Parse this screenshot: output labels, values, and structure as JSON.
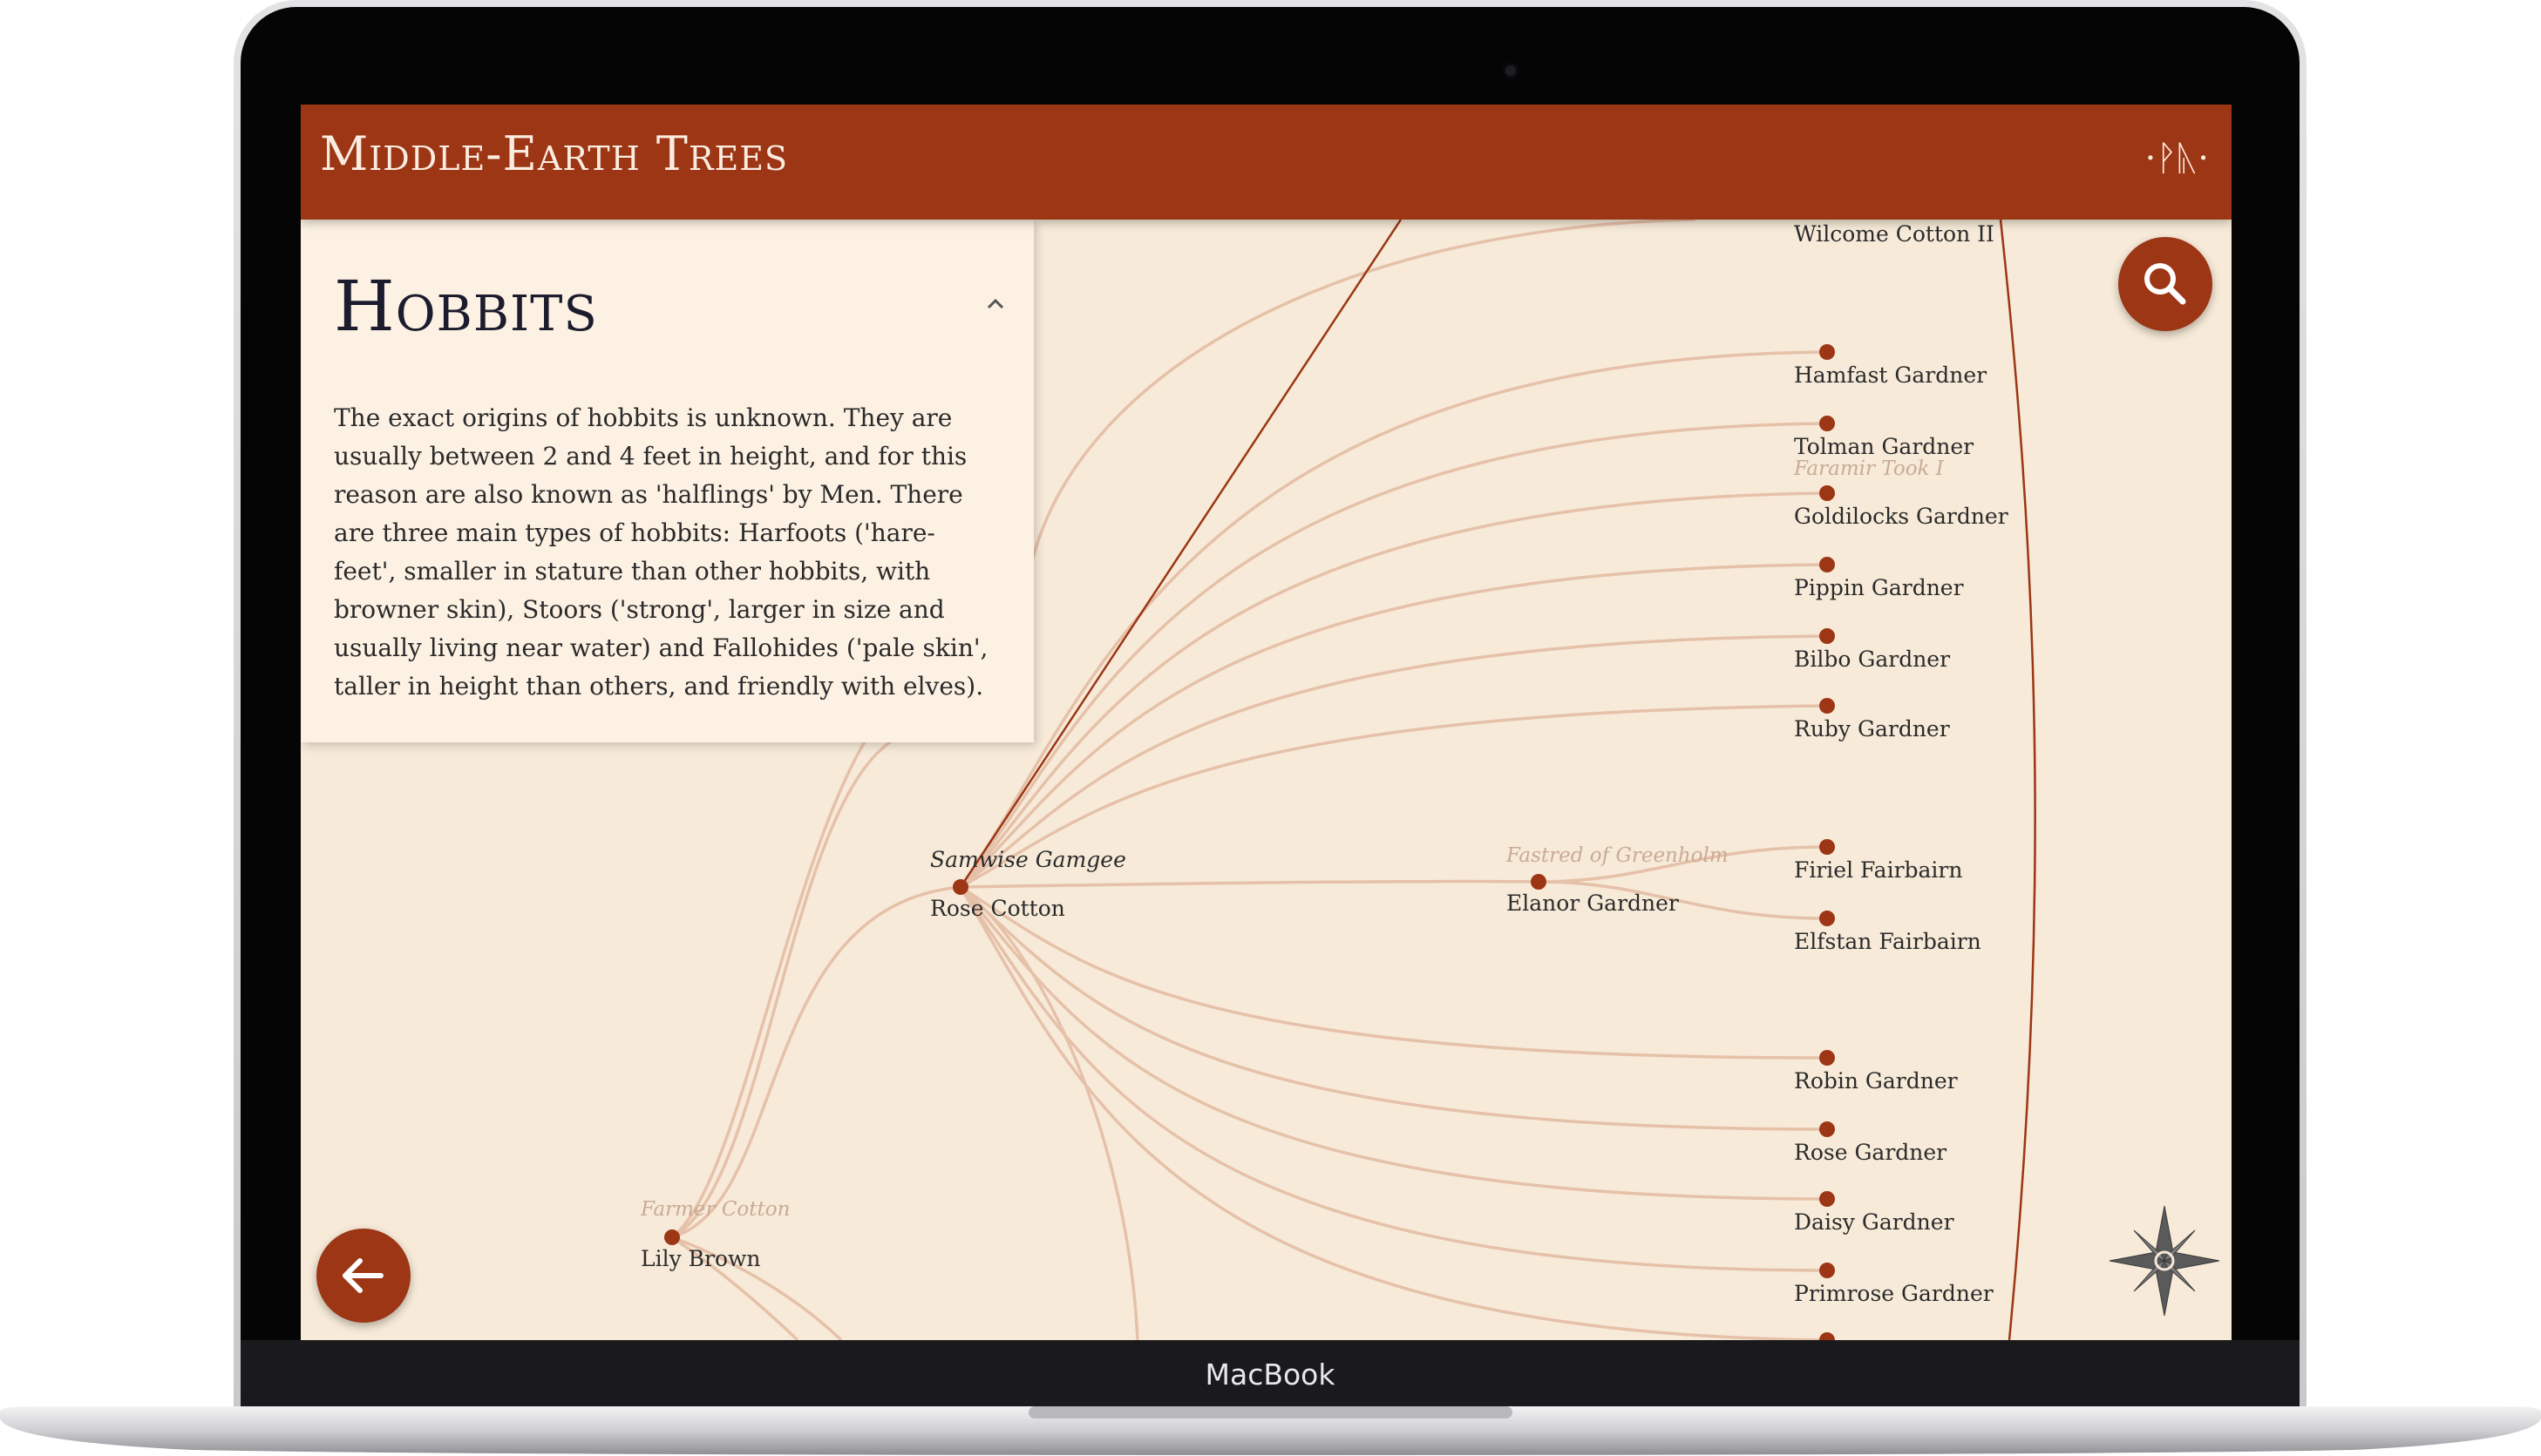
{
  "device": {
    "label": "MacBook"
  },
  "app": {
    "title": "Middle-Earth Trees",
    "glyph": "·ᚹᚣ·"
  },
  "panel": {
    "title": "Hobbits",
    "body": "The exact origins of hobbits is unknown. They are usually between 2 and 4 feet in height, and for this reason are also known as 'halflings' by Men. There are three main types of hobbits: Harfoots ('hare-feet', smaller in stature than other hobbits, with browner skin), Stoors ('strong', larger in size and usually living near water) and Fallohides ('pale skin', taller in height than others, and friendly with elves)."
  },
  "tree": {
    "couple": {
      "partner": "Samwise Gamgee",
      "name": "Rose Cotton"
    },
    "parent": {
      "partner": "Farmer Cotton",
      "name": "Lily Brown"
    },
    "elanor": {
      "partner": "Fastred of Greenholm",
      "name": "Elanor Gardner"
    },
    "faint_label": "Faramir Took I",
    "top_name": "Wilcome Cotton II",
    "children_top": [
      "Hamfast Gardner",
      "Tolman Gardner",
      "Goldilocks Gardner",
      "Pippin Gardner",
      "Bilbo Gardner",
      "Ruby Gardner"
    ],
    "grandchildren": [
      "Firiel Fairbairn",
      "Elfstan Fairbairn"
    ],
    "children_bottom": [
      "Robin Gardner",
      "Rose Gardner",
      "Daisy Gardner",
      "Primrose Gardner"
    ]
  },
  "icons": {
    "search": "search-icon",
    "back": "arrow-left-icon",
    "compass": "compass-rose-icon",
    "collapse": "chevron-up-icon"
  },
  "colors": {
    "accent": "#9c3615",
    "background": "#f7ead8",
    "panel": "#fcf1e3",
    "link": "#e3b8a0"
  }
}
